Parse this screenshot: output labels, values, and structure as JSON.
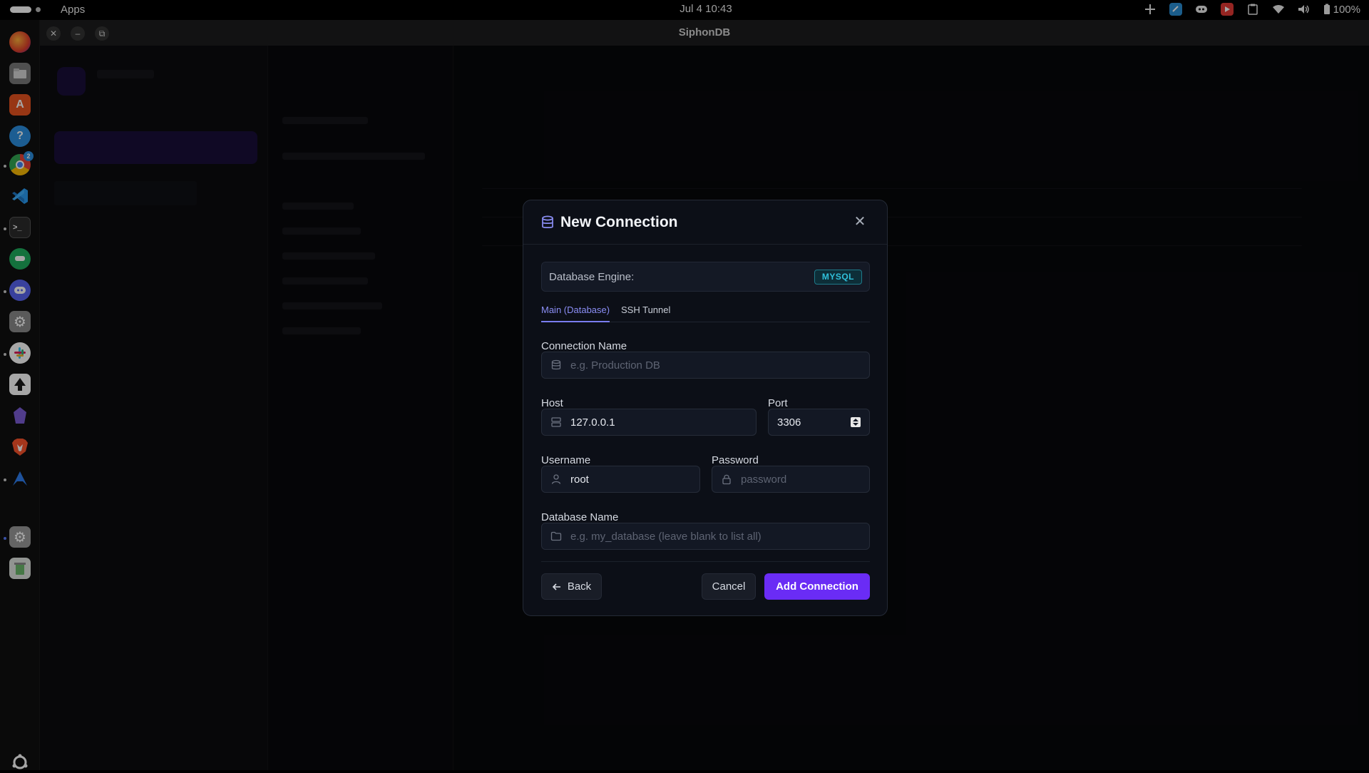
{
  "system_bar": {
    "apps_label": "Apps",
    "clock": "Jul 4  10:43",
    "battery": "100%"
  },
  "window": {
    "title": "SiphonDB",
    "close_glyph": "✕",
    "minimize_glyph": "–",
    "restore_glyph": "⧉"
  },
  "dock": {
    "icons": [
      "firefox-icon",
      "files-icon",
      "app-center-icon",
      "help-icon",
      "chrome-icon",
      "vscode-icon",
      "terminal-icon",
      "chat-icon",
      "discord-icon",
      "settings-icon",
      "slack-icon",
      "inkscape-icon",
      "obsidian-icon",
      "brave-icon",
      "arch-icon",
      "settings-alt-icon",
      "trash-icon",
      "ubuntu-icon"
    ],
    "chrome_badge": "2"
  },
  "modal": {
    "title": "New Connection",
    "close_glyph": "✕",
    "engine_label": "Database Engine:",
    "engine_value": "MYSQL",
    "tabs": [
      {
        "label": "Main (Database)",
        "active": true
      },
      {
        "label": "SSH Tunnel",
        "active": false
      }
    ],
    "connection_name": {
      "label": "Connection Name",
      "value": "",
      "placeholder": "e.g. Production DB"
    },
    "host": {
      "label": "Host",
      "value": "127.0.0.1"
    },
    "port": {
      "label": "Port",
      "value": "3306"
    },
    "username": {
      "label": "Username",
      "value": "root"
    },
    "password": {
      "label": "Password",
      "value": "",
      "placeholder": "password"
    },
    "database_name": {
      "label": "Database Name",
      "value": "",
      "placeholder": "e.g. my_database (leave blank to list all)"
    },
    "buttons": {
      "back": "Back",
      "cancel": "Cancel",
      "add": "Add Connection"
    }
  },
  "colors": {
    "accent": "#6a2cf5",
    "tab_active": "#8b8ef5",
    "badge": "#30c0da",
    "modal_bg": "#0c0f17"
  }
}
